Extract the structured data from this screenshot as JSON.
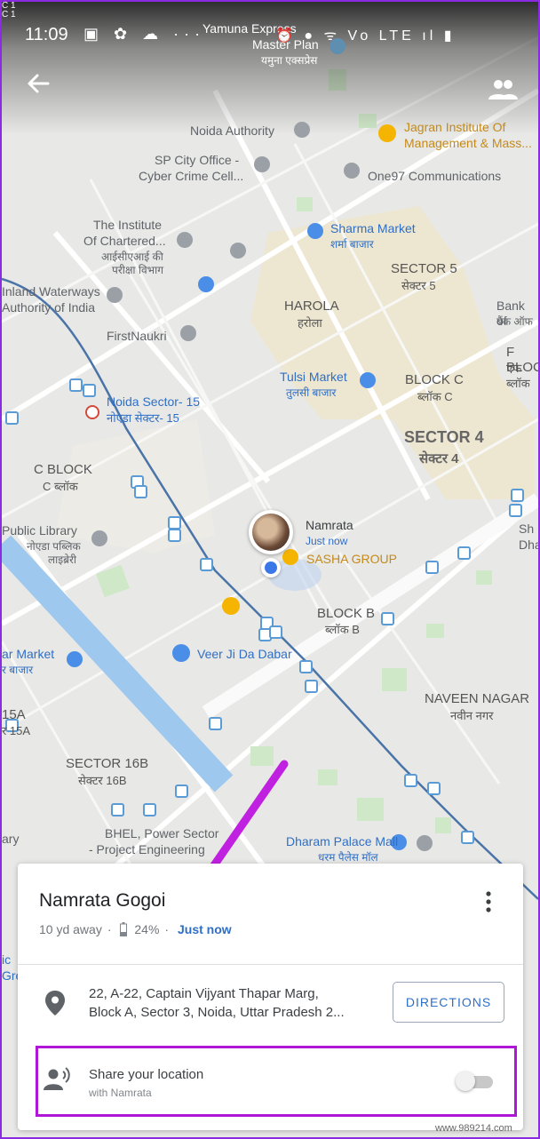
{
  "status_bar": {
    "small_top": "C 1\nC 1",
    "time": "11:09",
    "left_icons": "▣ ✿ ☁ ···",
    "right_icons": "⏰ ● ᯤ Vo LTE ıl ▮"
  },
  "toolbar": {
    "back_icon": "arrow-left-icon",
    "people_icon": "people-icon"
  },
  "map_labels": {
    "yamuna_1": "Yamuna Express",
    "yamuna_2": "Master Plan",
    "yamuna_3": "यमुना एक्सप्रेस",
    "noida_authority": "Noida Authority",
    "jagran_1": "Jagran Institute Of",
    "jagran_2": "Management & Mass...",
    "sp_city_1": "SP City Office -",
    "sp_city_2": "Cyber Crime Cell...",
    "one97": "One97 Communications",
    "institute_1": "The Institute",
    "institute_2": "Of Chartered...",
    "institute_3": "आईसीएआई की",
    "institute_4": "परीक्षा विभाग",
    "sharma_1": "Sharma Market",
    "sharma_2": "शर्मा बाजार",
    "sector5_1": "SECTOR 5",
    "sector5_2": "सेक्टर 5",
    "inland_1": "Inland Waterways",
    "inland_2": "Authority of India",
    "harola_1": "HAROLA",
    "harola_2": "हरोला",
    "bank_1": "Bank of",
    "bank_2": "बैंक ऑफ",
    "firstnaukri": "FirstNaukri",
    "fblock_1": "F BLOCK",
    "fblock_2": "एफ ब्लॉक",
    "tulsi_1": "Tulsi Market",
    "tulsi_2": "तुलसी बाजार",
    "blockc_1": "BLOCK C",
    "blockc_2": "ब्लॉक C",
    "noida15_1": "Noida Sector- 15",
    "noida15_2": "नोएडा सेक्टर- 15",
    "sector4_1": "SECTOR 4",
    "sector4_2": "सेक्टर 4",
    "cblock_1": "C BLOCK",
    "cblock_2": "C ब्लॉक",
    "library_1": "Public Library",
    "library_2": "नोएडा पब्लिक",
    "library_3": "लाइब्रेरी",
    "avatar_name": "Namrata",
    "avatar_time": "Just now",
    "sasha": "SASHA GROUP",
    "sh_1": "Sh",
    "sh_2": "Dha",
    "blockb_1": "BLOCK B",
    "blockb_2": "ब्लॉक B",
    "veer": "Veer Ji Da Dabar",
    "ar_market_1": "ar Market",
    "ar_market_2": "र बाजार",
    "naveen_1": "NAVEEN NAGAR",
    "naveen_2": "नवीन नगर",
    "s15a_1": "15A",
    "s15a_2": "र 15A",
    "sector16b_1": "SECTOR 16B",
    "sector16b_2": "सेक्टर 16B",
    "bhel_1": "BHEL, Power Sector",
    "bhel_2": "- Project Engineering",
    "dharam_1": "Dharam Palace Mall",
    "dharam_2": "धरम पैलेस मॉल",
    "ary": "ary",
    "left_ic": "ic",
    "left_gre": "Gre"
  },
  "card": {
    "name": "Namrata Gogoi",
    "distance": "10 yd away",
    "battery": "24%",
    "updated": "Just now",
    "address_line1": "22, A-22, Captain Vijyant Thapar Marg,",
    "address_line2": "Block A, Sector 3, Noida, Uttar Pradesh 2...",
    "directions_label": "DIRECTIONS",
    "share_title": "Share your location",
    "share_subtitle": "with Namrata",
    "share_enabled": false
  },
  "watermark": "www.989214.com",
  "colors": {
    "accent": "#2f6fc6",
    "highlight": "#b016d8",
    "arrow": "#c020e0"
  }
}
